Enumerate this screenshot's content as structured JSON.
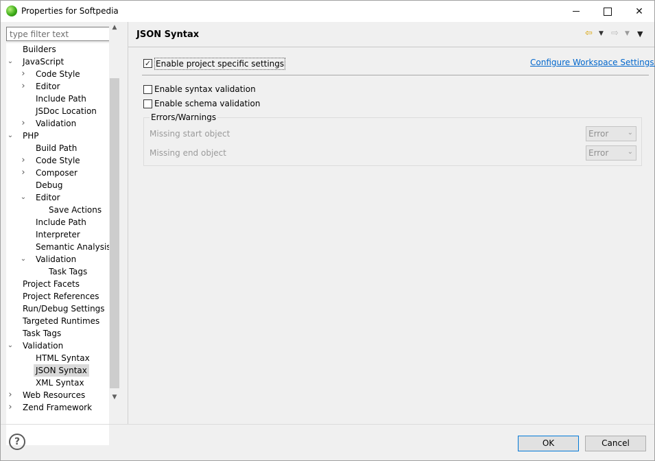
{
  "window": {
    "title": "Properties for Softpedia"
  },
  "filter": {
    "placeholder": "type filter text"
  },
  "tree": [
    {
      "label": "Builders",
      "depth": 0,
      "twisty": ""
    },
    {
      "label": "JavaScript",
      "depth": 0,
      "twisty": "open"
    },
    {
      "label": "Code Style",
      "depth": 1,
      "twisty": "closed"
    },
    {
      "label": "Editor",
      "depth": 1,
      "twisty": "closed"
    },
    {
      "label": "Include Path",
      "depth": 1,
      "twisty": ""
    },
    {
      "label": "JSDoc Location",
      "depth": 1,
      "twisty": ""
    },
    {
      "label": "Validation",
      "depth": 1,
      "twisty": "closed"
    },
    {
      "label": "PHP",
      "depth": 0,
      "twisty": "open"
    },
    {
      "label": "Build Path",
      "depth": 1,
      "twisty": ""
    },
    {
      "label": "Code Style",
      "depth": 1,
      "twisty": "closed"
    },
    {
      "label": "Composer",
      "depth": 1,
      "twisty": "closed"
    },
    {
      "label": "Debug",
      "depth": 1,
      "twisty": ""
    },
    {
      "label": "Editor",
      "depth": 1,
      "twisty": "open"
    },
    {
      "label": "Save Actions",
      "depth": 2,
      "twisty": ""
    },
    {
      "label": "Include Path",
      "depth": 1,
      "twisty": ""
    },
    {
      "label": "Interpreter",
      "depth": 1,
      "twisty": ""
    },
    {
      "label": "Semantic Analysis",
      "depth": 1,
      "twisty": ""
    },
    {
      "label": "Validation",
      "depth": 1,
      "twisty": "open"
    },
    {
      "label": "Task Tags",
      "depth": 2,
      "twisty": ""
    },
    {
      "label": "Project Facets",
      "depth": 0,
      "twisty": ""
    },
    {
      "label": "Project References",
      "depth": 0,
      "twisty": ""
    },
    {
      "label": "Run/Debug Settings",
      "depth": 0,
      "twisty": ""
    },
    {
      "label": "Targeted Runtimes",
      "depth": 0,
      "twisty": ""
    },
    {
      "label": "Task Tags",
      "depth": 0,
      "twisty": ""
    },
    {
      "label": "Validation",
      "depth": 0,
      "twisty": "open"
    },
    {
      "label": "HTML Syntax",
      "depth": 1,
      "twisty": ""
    },
    {
      "label": "JSON Syntax",
      "depth": 1,
      "twisty": "",
      "selected": true
    },
    {
      "label": "XML Syntax",
      "depth": 1,
      "twisty": ""
    },
    {
      "label": "Web Resources",
      "depth": 0,
      "twisty": "closed"
    },
    {
      "label": "Zend Framework",
      "depth": 0,
      "twisty": "closed"
    }
  ],
  "page": {
    "title": "JSON Syntax",
    "project_specific": {
      "label": "Enable project specific settings",
      "checked": true
    },
    "configure_link": "Configure Workspace Settings...",
    "syntax_validation": {
      "label": "Enable syntax validation",
      "checked": false
    },
    "schema_validation": {
      "label": "Enable schema validation",
      "checked": false
    },
    "group": {
      "title": "Errors/Warnings",
      "rows": [
        {
          "label": "Missing start object",
          "value": "Error"
        },
        {
          "label": "Missing end object",
          "value": "Error"
        }
      ]
    }
  },
  "footer": {
    "help": "?",
    "ok": "OK",
    "cancel": "Cancel"
  },
  "icons": {
    "app": "eclipse-green-orb-icon",
    "back": "back-arrow-icon",
    "forward": "forward-arrow-icon",
    "menu": "view-menu-icon"
  }
}
